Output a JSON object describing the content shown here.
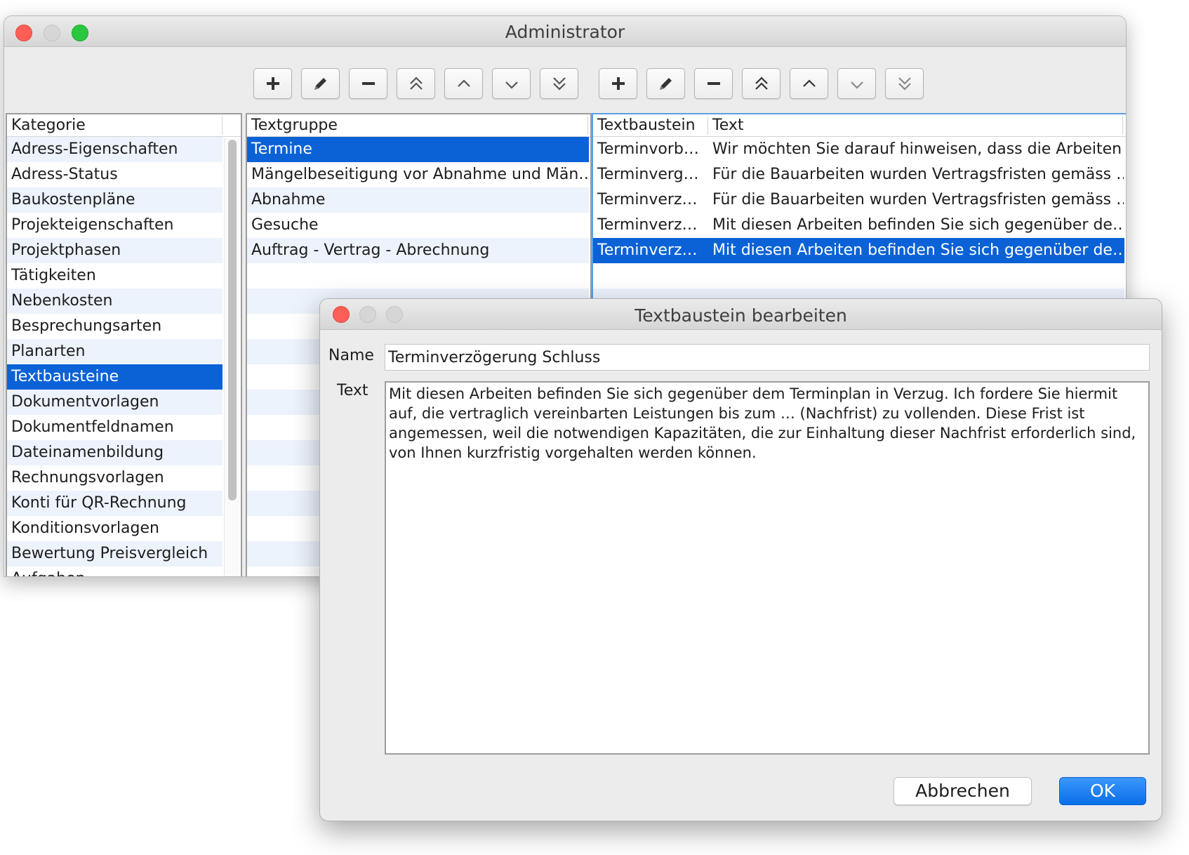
{
  "main_window": {
    "title": "Administrator"
  },
  "toolbar": {
    "left_group": [
      {
        "icon": "plus-icon",
        "tooltip": ""
      },
      {
        "icon": "pencil-icon",
        "tooltip": ""
      },
      {
        "icon": "minus-icon",
        "tooltip": ""
      },
      {
        "icon": "double-chevron-up-icon",
        "tooltip": ""
      },
      {
        "icon": "chevron-up-icon",
        "tooltip": ""
      },
      {
        "icon": "chevron-down-icon",
        "tooltip": ""
      },
      {
        "icon": "double-chevron-down-icon",
        "tooltip": ""
      }
    ],
    "right_group": [
      {
        "icon": "plus-icon"
      },
      {
        "icon": "pencil-icon"
      },
      {
        "icon": "minus-icon"
      },
      {
        "icon": "double-chevron-up-icon"
      },
      {
        "icon": "chevron-up-icon"
      },
      {
        "icon": "chevron-down-icon"
      },
      {
        "icon": "double-chevron-down-icon"
      }
    ]
  },
  "kategorie": {
    "header": "Kategorie",
    "items": [
      "Adress-Eigenschaften",
      "Adress-Status",
      "Baukostenpläne",
      "Projekteigenschaften",
      "Projektphasen",
      "Tätigkeiten",
      "Nebenkosten",
      "Besprechungsarten",
      "Planarten",
      "Textbausteine",
      "Dokumentvorlagen",
      "Dokumentfeldnamen",
      "Dateinamenbildung",
      "Rechnungsvorlagen",
      "Konti für QR-Rechnung",
      "Konditionsvorlagen",
      "Bewertung Preisvergleich",
      "Aufgaben"
    ],
    "selected_index": 9
  },
  "textgruppe": {
    "header": "Textgruppe",
    "items": [
      "Termine",
      "Mängelbeseitigung vor Abnahme und Män…",
      "Abnahme",
      "Gesuche",
      "Auftrag - Vertrag - Abrechnung"
    ],
    "selected_index": 0
  },
  "textbausteine": {
    "headers": [
      "Textbaustein",
      "Text"
    ],
    "rows": [
      [
        "Terminvorb…",
        "Wir möchten Sie darauf hinweisen, dass die Arbeiten …"
      ],
      [
        "Terminverg…",
        "Für die Bauarbeiten wurden Vertragsfristen gemäss …."
      ],
      [
        "Terminverz…",
        "Für die Bauarbeiten wurden Vertragsfristen gemäss …."
      ],
      [
        "Terminverz…",
        "Mit diesen Arbeiten befinden Sie sich gegenüber de…"
      ],
      [
        "Terminverz…",
        "Mit diesen Arbeiten befinden Sie sich gegenüber de…"
      ]
    ],
    "selected_index": 4
  },
  "dialog": {
    "title": "Textbaustein bearbeiten",
    "name_label": "Name",
    "name_value": "Terminverzögerung Schluss",
    "text_label": "Text",
    "text_value": "Mit diesen Arbeiten befinden Sie sich gegenüber dem Terminplan in Verzug. Ich fordere Sie hiermit auf, die vertraglich vereinbarten Leistungen bis zum … (Nachfrist) zu vollenden. Diese Frist ist angemessen, weil die notwendigen Kapazitäten, die zur Einhaltung dieser Nachfrist erforderlich sind, von Ihnen kurzfristig vorgehalten werden können.",
    "cancel_label": "Abbrechen",
    "ok_label": "OK"
  },
  "colors": {
    "selection": "#0a62d6",
    "alt_row": "#edf3fd",
    "ok_button": "#0a6ee8"
  }
}
